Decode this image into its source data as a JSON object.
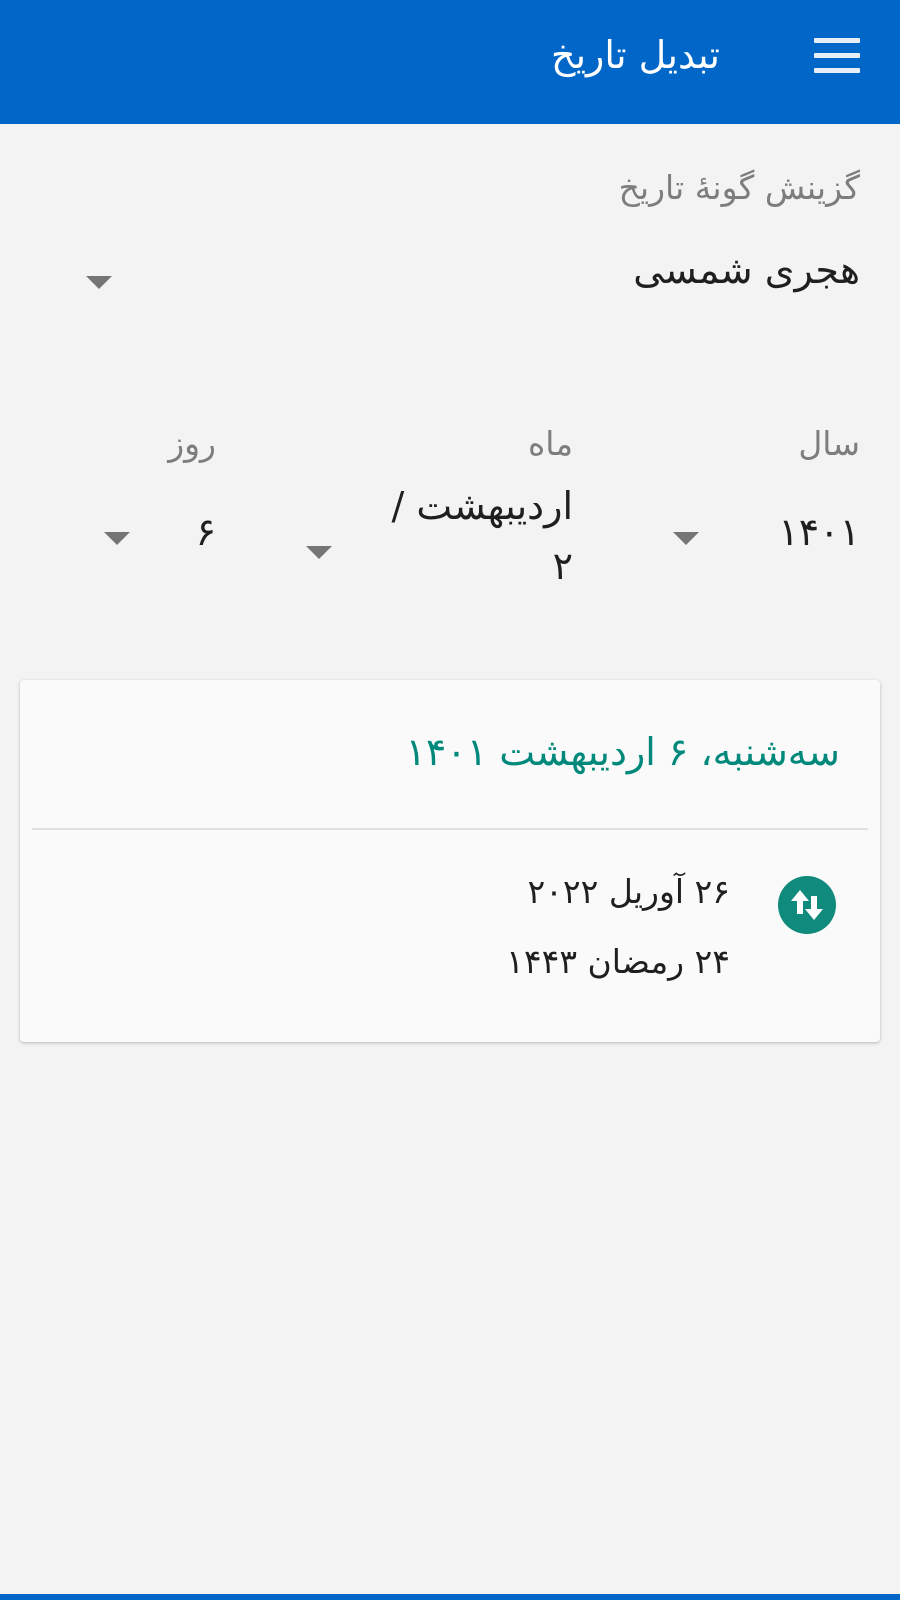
{
  "appbar": {
    "title": "تبدیل تاریخ",
    "menu_icon": "hamburger-menu-icon",
    "color": "#0066c7"
  },
  "calendar_type": {
    "label": "گزینش گونهٔ تاریخ",
    "selected": "هجری شمسی"
  },
  "date_fields": {
    "year": {
      "label": "سال",
      "value": "۱۴۰۱"
    },
    "month": {
      "label": "ماه",
      "value_line1": "اردیبهشت /",
      "value_line2": "۲"
    },
    "day": {
      "label": "روز",
      "value": "۶"
    }
  },
  "result": {
    "title": "سه‌شنبه، ۶ اردیبهشت ۱۴۰۱",
    "title_color": "#00897b",
    "icon": "swap-vertical-icon",
    "gregorian": "۲۶ آوریل ۲۰۲۲",
    "hijri": "۲۴ رمضان ۱۴۴۳"
  }
}
